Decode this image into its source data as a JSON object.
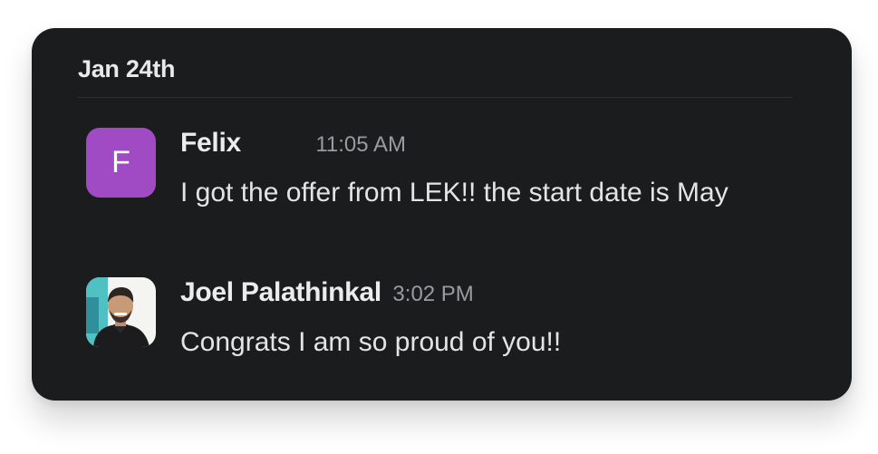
{
  "day_divider": {
    "label": "Jan 24th"
  },
  "messages": [
    {
      "avatar_letter": "F",
      "avatar_color": "#a04bc4",
      "author": "Felix",
      "time": "11:05 AM",
      "text": "I got the offer from LEK!! the start date is May"
    },
    {
      "avatar_icon": "user-photo-avatar",
      "author": "Joel Palathinkal",
      "time": "3:02 PM",
      "text": "Congrats I am so proud of you!!"
    }
  ],
  "colors": {
    "card_background": "#1b1c1e",
    "author_text": "#ececec",
    "timestamp_text": "#9a9b9e"
  }
}
